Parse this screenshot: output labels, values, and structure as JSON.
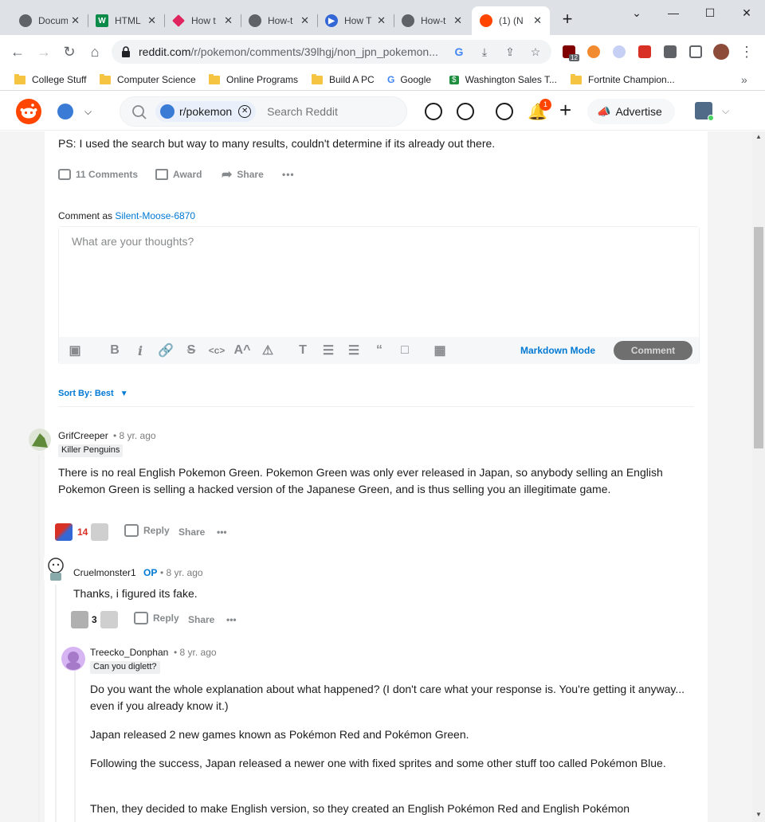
{
  "browser": {
    "tabs": [
      {
        "title": "Docum",
        "fav_color": "#5f6368",
        "fav_glyph": ""
      },
      {
        "title": "HTML",
        "fav_color": "#0b8a4a",
        "fav_glyph": "W"
      },
      {
        "title": "How t",
        "fav_color": "#e0245e",
        "fav_glyph": ""
      },
      {
        "title": "How-t",
        "fav_color": "#5f6368",
        "fav_glyph": ""
      },
      {
        "title": "How T",
        "fav_color": "#3367d6",
        "fav_glyph": "▶"
      },
      {
        "title": "How-t",
        "fav_color": "#5f6368",
        "fav_glyph": ""
      },
      {
        "title": "(1) (N",
        "fav_color": "#ff4500",
        "fav_glyph": ""
      }
    ],
    "new_tab": "+",
    "window_controls": [
      "⌄",
      "—",
      "☐",
      "✕"
    ],
    "url_host": "reddit.com",
    "url_path": "/r/pokemon/comments/39lhgj/non_jpn_pokemon...",
    "ext_badge": "12",
    "bookmarks": [
      {
        "label": "College Stuff",
        "icon": "folder"
      },
      {
        "label": "Computer Science",
        "icon": "folder"
      },
      {
        "label": "Online Programs",
        "icon": "folder"
      },
      {
        "label": "Build A PC",
        "icon": "folder"
      },
      {
        "label": "Google",
        "icon": "google-icon"
      },
      {
        "label": "Washington Sales T...",
        "icon": "dollar-icon"
      },
      {
        "label": "Fortnite Champion...",
        "icon": "folder"
      }
    ],
    "bookmarks_more": "»"
  },
  "reddit": {
    "search_chip": "r/pokemon",
    "search_placeholder": "Search Reddit",
    "notif_count": "1",
    "advertise": "Advertise"
  },
  "post": {
    "ps_text": "PS: I used the search but way to many results, couldn't determine if its already out there.",
    "comments": "11 Comments",
    "award": "Award",
    "share": "Share",
    "more": "•••"
  },
  "composer": {
    "comment_as_prefix": "Comment as ",
    "username": "Silent-Moose-6870",
    "placeholder": "What are your thoughts?",
    "markdown_mode": "Markdown Mode",
    "comment_button": "Comment"
  },
  "sort": {
    "label": "Sort By: Best"
  },
  "comments": [
    {
      "user": "GrifCreeper",
      "age": "8 yr. ago",
      "flair": "Killer Penguins",
      "body": "There is no real English Pokemon Green. Pokemon Green was only ever released in Japan, so anybody selling an English Pokemon Green is selling a hacked version of the Japanese Green, and is thus selling you an illegitimate game.",
      "votes": "14",
      "reply": "Reply",
      "share": "Share",
      "more": "•••"
    },
    {
      "user": "Cruelmonster1",
      "op": "OP",
      "age": "8 yr. ago",
      "body": "Thanks, i figured its fake.",
      "votes": "3",
      "reply": "Reply",
      "share": "Share",
      "more": "•••"
    },
    {
      "user": "Treecko_Donphan",
      "age": "8 yr. ago",
      "flair": "Can you diglett?",
      "paragraphs": [
        "Do you want the whole explanation about what happened? (I don't care what your response is. You're getting it anyway... even if you already know it.)",
        "Japan released 2 new games known as Pokémon Red and Pokémon Green.",
        "Following the success, Japan released a newer one with fixed sprites and some other stuff too called Pokémon Blue.",
        "Then, they decided to make English version, so they created an English Pokémon Red and English Pokémon"
      ]
    }
  ]
}
